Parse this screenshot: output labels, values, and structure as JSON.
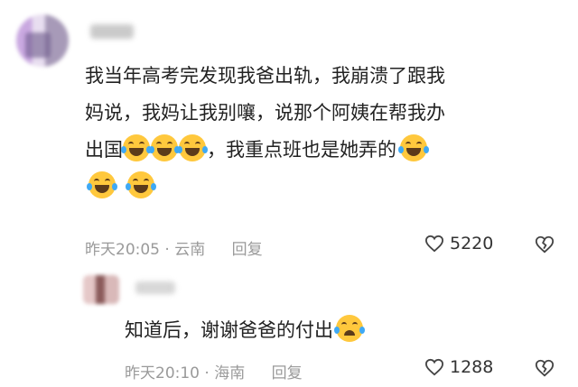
{
  "comments": [
    {
      "lines": [
        "我当年高考完发现我爸出轨，我崩溃了跟我",
        "妈说，我妈让我别嚷，说那个阿姨在帮我办",
        "出国",
        "，我重点班也是她弄的"
      ],
      "time": "昨天20:05",
      "location": "云南",
      "reply_label": "回复",
      "likes": "5220"
    },
    {
      "text": "知道后，谢谢爸爸的付出",
      "time": "昨天20:10",
      "location": "海南",
      "reply_label": "回复",
      "likes": "1288"
    }
  ],
  "separator": "·",
  "icons": {
    "laugh": "laugh-cry-emoji",
    "cry": "crying-face-emoji",
    "like": "heart-outline-icon",
    "dislike": "broken-heart-icon"
  }
}
